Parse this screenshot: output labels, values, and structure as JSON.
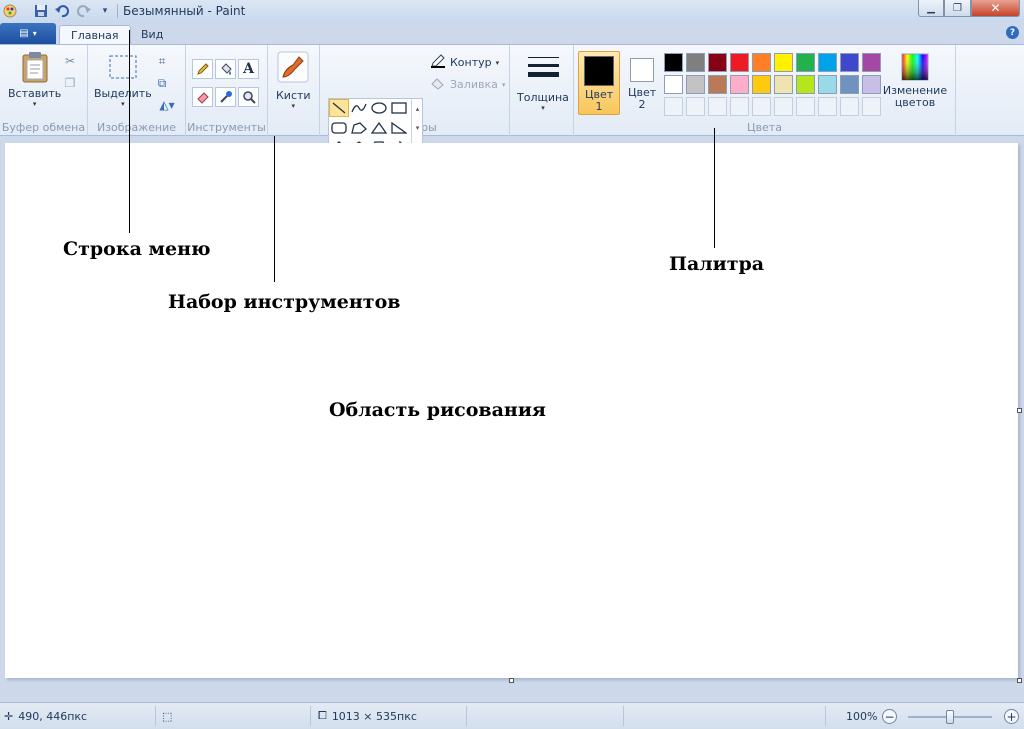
{
  "window": {
    "title": "Безымянный - Paint"
  },
  "tabs": [
    {
      "label": "Главная"
    },
    {
      "label": "Вид"
    }
  ],
  "ribbon": {
    "clipboard": {
      "group_label": "Буфер обмена",
      "paste_label": "Вставить"
    },
    "image": {
      "group_label": "Изображение",
      "select_label": "Выделить"
    },
    "tools": {
      "group_label": "Инструменты"
    },
    "brushes": {
      "label": "Кисти"
    },
    "shapes": {
      "group_label": "Фигуры",
      "outline_label": "Контур",
      "fill_label": "Заливка"
    },
    "size": {
      "label": "Толщина"
    },
    "colors": {
      "group_label": "Цвета",
      "color1_label": "Цвет 1",
      "color2_label": "Цвет 2",
      "edit_colors_label": "Изменение цветов",
      "color1": "#000000",
      "color2": "#ffffff",
      "palette_row1": [
        "#000000",
        "#7f7f7f",
        "#880015",
        "#ed1c24",
        "#ff7f27",
        "#fff200",
        "#22b14c",
        "#00a2e8",
        "#3f48cc",
        "#a349a4"
      ],
      "palette_row2": [
        "#ffffff",
        "#c3c3c3",
        "#b97a57",
        "#ffaec9",
        "#ffc90e",
        "#efe4b0",
        "#b5e61d",
        "#99d9ea",
        "#7092be",
        "#c8bfe7"
      ]
    }
  },
  "annotations": {
    "menu_bar": "Строка меню",
    "toolbox": "Набор инструментов",
    "palette": "Палитра",
    "drawing_area": "Область рисования"
  },
  "statusbar": {
    "cursor_pos": "490, 446пкс",
    "canvas_size": "1013 × 535пкс",
    "zoom": "100%"
  }
}
